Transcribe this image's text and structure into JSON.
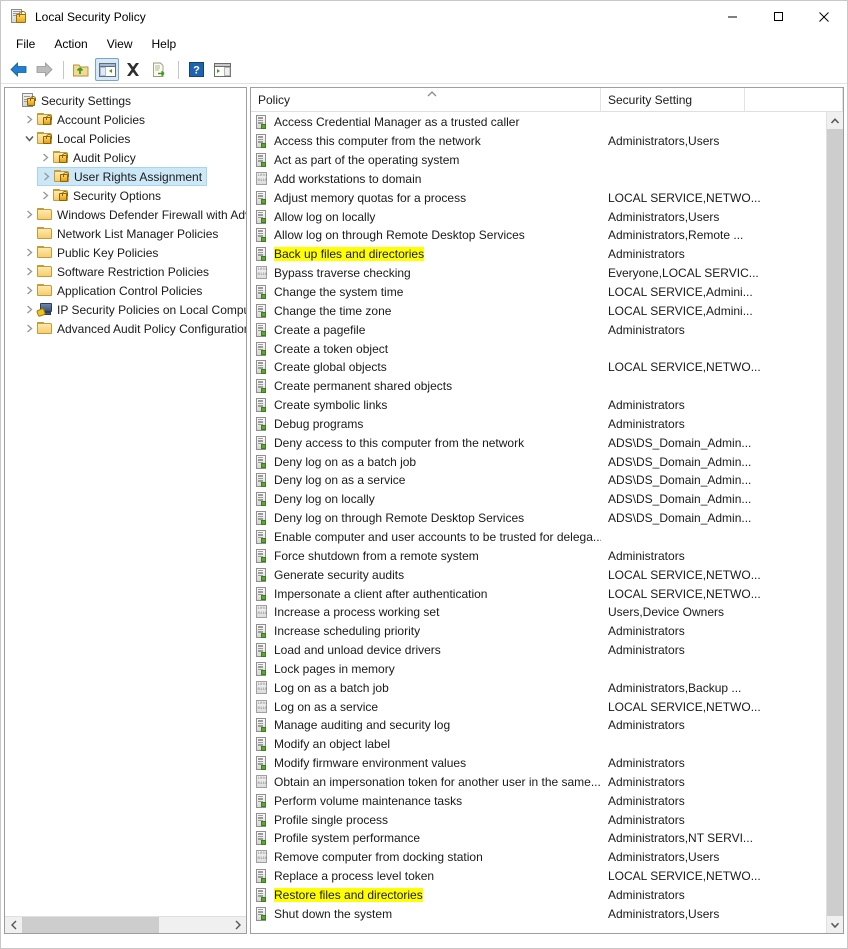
{
  "window": {
    "title": "Local Security Policy",
    "icon": "security-policy-icon",
    "controls": {
      "minimize": "–",
      "maximize": "□",
      "close": "✕"
    }
  },
  "menubar": {
    "items": [
      "File",
      "Action",
      "View",
      "Help"
    ]
  },
  "toolbar": {
    "items": [
      {
        "name": "back-button",
        "icon": "left-arrow-icon",
        "enabled": true
      },
      {
        "name": "forward-button",
        "icon": "right-arrow-icon",
        "enabled": false
      },
      {
        "name": "separator-1",
        "icon": "separator"
      },
      {
        "name": "up-one-level-button",
        "icon": "folder-up-icon"
      },
      {
        "name": "show-hide-console-tree-button",
        "icon": "console-tree-icon",
        "active": true
      },
      {
        "name": "delete-button",
        "icon": "delete-x-icon"
      },
      {
        "name": "export-list-button",
        "icon": "export-list-icon"
      },
      {
        "name": "separator-2",
        "icon": "separator"
      },
      {
        "name": "help-button",
        "icon": "question-mark-icon"
      },
      {
        "name": "show-hide-action-pane-button",
        "icon": "action-pane-icon"
      }
    ]
  },
  "tree": {
    "items": [
      {
        "label": "Security Settings",
        "level": 0,
        "expander": "none",
        "icon": "security-settings-icon",
        "selected": false
      },
      {
        "label": "Account Policies",
        "level": 1,
        "expander": "collapsed",
        "icon": "folder-lock-icon",
        "selected": false
      },
      {
        "label": "Local Policies",
        "level": 1,
        "expander": "expanded",
        "icon": "folder-lock-icon",
        "selected": false
      },
      {
        "label": "Audit Policy",
        "level": 2,
        "expander": "collapsed",
        "icon": "folder-lock-icon",
        "selected": false
      },
      {
        "label": "User Rights Assignment",
        "level": 2,
        "expander": "collapsed",
        "icon": "folder-lock-icon",
        "selected": true
      },
      {
        "label": "Security Options",
        "level": 2,
        "expander": "collapsed",
        "icon": "folder-lock-icon",
        "selected": false
      },
      {
        "label": "Windows Defender Firewall with Adva",
        "level": 1,
        "expander": "collapsed",
        "icon": "folder-icon",
        "selected": false
      },
      {
        "label": "Network List Manager Policies",
        "level": 1,
        "expander": "none",
        "icon": "folder-icon",
        "selected": false
      },
      {
        "label": "Public Key Policies",
        "level": 1,
        "expander": "collapsed",
        "icon": "folder-icon",
        "selected": false
      },
      {
        "label": "Software Restriction Policies",
        "level": 1,
        "expander": "collapsed",
        "icon": "folder-icon",
        "selected": false
      },
      {
        "label": "Application Control Policies",
        "level": 1,
        "expander": "collapsed",
        "icon": "folder-icon",
        "selected": false
      },
      {
        "label": "IP Security Policies on Local Compute",
        "level": 1,
        "expander": "collapsed",
        "icon": "ipsec-icon",
        "selected": false
      },
      {
        "label": "Advanced Audit Policy Configuration",
        "level": 1,
        "expander": "collapsed",
        "icon": "folder-icon",
        "selected": false
      }
    ]
  },
  "list": {
    "columns": [
      {
        "label": "Policy",
        "sorted": "ascending"
      },
      {
        "label": "Security Setting",
        "sorted": "none"
      }
    ],
    "highlight_color": "#ffff00",
    "rows": [
      {
        "policy": "Access Credential Manager as a trusted caller",
        "setting": "",
        "icon": "policy-icon",
        "highlighted": false
      },
      {
        "policy": "Access this computer from the network",
        "setting": "Administrators,Users",
        "icon": "policy-icon",
        "highlighted": false
      },
      {
        "policy": "Act as part of the operating system",
        "setting": "",
        "icon": "policy-icon",
        "highlighted": false
      },
      {
        "policy": "Add workstations to domain",
        "setting": "",
        "icon": "policy-disabled-icon",
        "highlighted": false
      },
      {
        "policy": "Adjust memory quotas for a process",
        "setting": "LOCAL SERVICE,NETWO...",
        "icon": "policy-icon",
        "highlighted": false
      },
      {
        "policy": "Allow log on locally",
        "setting": "Administrators,Users",
        "icon": "policy-icon",
        "highlighted": false
      },
      {
        "policy": "Allow log on through Remote Desktop Services",
        "setting": "Administrators,Remote ...",
        "icon": "policy-icon",
        "highlighted": false
      },
      {
        "policy": "Back up files and directories",
        "setting": "Administrators",
        "icon": "policy-icon",
        "highlighted": true
      },
      {
        "policy": "Bypass traverse checking",
        "setting": "Everyone,LOCAL SERVIC...",
        "icon": "policy-disabled-icon",
        "highlighted": false
      },
      {
        "policy": "Change the system time",
        "setting": "LOCAL SERVICE,Admini...",
        "icon": "policy-icon",
        "highlighted": false
      },
      {
        "policy": "Change the time zone",
        "setting": "LOCAL SERVICE,Admini...",
        "icon": "policy-icon",
        "highlighted": false
      },
      {
        "policy": "Create a pagefile",
        "setting": "Administrators",
        "icon": "policy-icon",
        "highlighted": false
      },
      {
        "policy": "Create a token object",
        "setting": "",
        "icon": "policy-icon",
        "highlighted": false
      },
      {
        "policy": "Create global objects",
        "setting": "LOCAL SERVICE,NETWO...",
        "icon": "policy-icon",
        "highlighted": false
      },
      {
        "policy": "Create permanent shared objects",
        "setting": "",
        "icon": "policy-icon",
        "highlighted": false
      },
      {
        "policy": "Create symbolic links",
        "setting": "Administrators",
        "icon": "policy-icon",
        "highlighted": false
      },
      {
        "policy": "Debug programs",
        "setting": "Administrators",
        "icon": "policy-icon",
        "highlighted": false
      },
      {
        "policy": "Deny access to this computer from the network",
        "setting": "ADS\\DS_Domain_Admin...",
        "icon": "policy-icon",
        "highlighted": false
      },
      {
        "policy": "Deny log on as a batch job",
        "setting": "ADS\\DS_Domain_Admin...",
        "icon": "policy-icon",
        "highlighted": false
      },
      {
        "policy": "Deny log on as a service",
        "setting": "ADS\\DS_Domain_Admin...",
        "icon": "policy-icon",
        "highlighted": false
      },
      {
        "policy": "Deny log on locally",
        "setting": "ADS\\DS_Domain_Admin...",
        "icon": "policy-icon",
        "highlighted": false
      },
      {
        "policy": "Deny log on through Remote Desktop Services",
        "setting": "ADS\\DS_Domain_Admin...",
        "icon": "policy-icon",
        "highlighted": false
      },
      {
        "policy": "Enable computer and user accounts to be trusted for delega...",
        "setting": "",
        "icon": "policy-icon",
        "highlighted": false
      },
      {
        "policy": "Force shutdown from a remote system",
        "setting": "Administrators",
        "icon": "policy-icon",
        "highlighted": false
      },
      {
        "policy": "Generate security audits",
        "setting": "LOCAL SERVICE,NETWO...",
        "icon": "policy-icon",
        "highlighted": false
      },
      {
        "policy": "Impersonate a client after authentication",
        "setting": "LOCAL SERVICE,NETWO...",
        "icon": "policy-icon",
        "highlighted": false
      },
      {
        "policy": "Increase a process working set",
        "setting": "Users,Device Owners",
        "icon": "policy-disabled-icon",
        "highlighted": false
      },
      {
        "policy": "Increase scheduling priority",
        "setting": "Administrators",
        "icon": "policy-icon",
        "highlighted": false
      },
      {
        "policy": "Load and unload device drivers",
        "setting": "Administrators",
        "icon": "policy-icon",
        "highlighted": false
      },
      {
        "policy": "Lock pages in memory",
        "setting": "",
        "icon": "policy-icon",
        "highlighted": false
      },
      {
        "policy": "Log on as a batch job",
        "setting": "Administrators,Backup ...",
        "icon": "policy-disabled-icon",
        "highlighted": false
      },
      {
        "policy": "Log on as a service",
        "setting": "LOCAL SERVICE,NETWO...",
        "icon": "policy-disabled-icon",
        "highlighted": false
      },
      {
        "policy": "Manage auditing and security log",
        "setting": "Administrators",
        "icon": "policy-icon",
        "highlighted": false
      },
      {
        "policy": "Modify an object label",
        "setting": "",
        "icon": "policy-icon",
        "highlighted": false
      },
      {
        "policy": "Modify firmware environment values",
        "setting": "Administrators",
        "icon": "policy-icon",
        "highlighted": false
      },
      {
        "policy": "Obtain an impersonation token for another user in the same...",
        "setting": "Administrators",
        "icon": "policy-disabled-icon",
        "highlighted": false
      },
      {
        "policy": "Perform volume maintenance tasks",
        "setting": "Administrators",
        "icon": "policy-icon",
        "highlighted": false
      },
      {
        "policy": "Profile single process",
        "setting": "Administrators",
        "icon": "policy-icon",
        "highlighted": false
      },
      {
        "policy": "Profile system performance",
        "setting": "Administrators,NT SERVI...",
        "icon": "policy-icon",
        "highlighted": false
      },
      {
        "policy": "Remove computer from docking station",
        "setting": "Administrators,Users",
        "icon": "policy-disabled-icon",
        "highlighted": false
      },
      {
        "policy": "Replace a process level token",
        "setting": "LOCAL SERVICE,NETWO...",
        "icon": "policy-icon",
        "highlighted": false
      },
      {
        "policy": "Restore files and directories",
        "setting": "Administrators",
        "icon": "policy-icon",
        "highlighted": true
      },
      {
        "policy": "Shut down the system",
        "setting": "Administrators,Users",
        "icon": "policy-icon",
        "highlighted": false
      }
    ]
  }
}
